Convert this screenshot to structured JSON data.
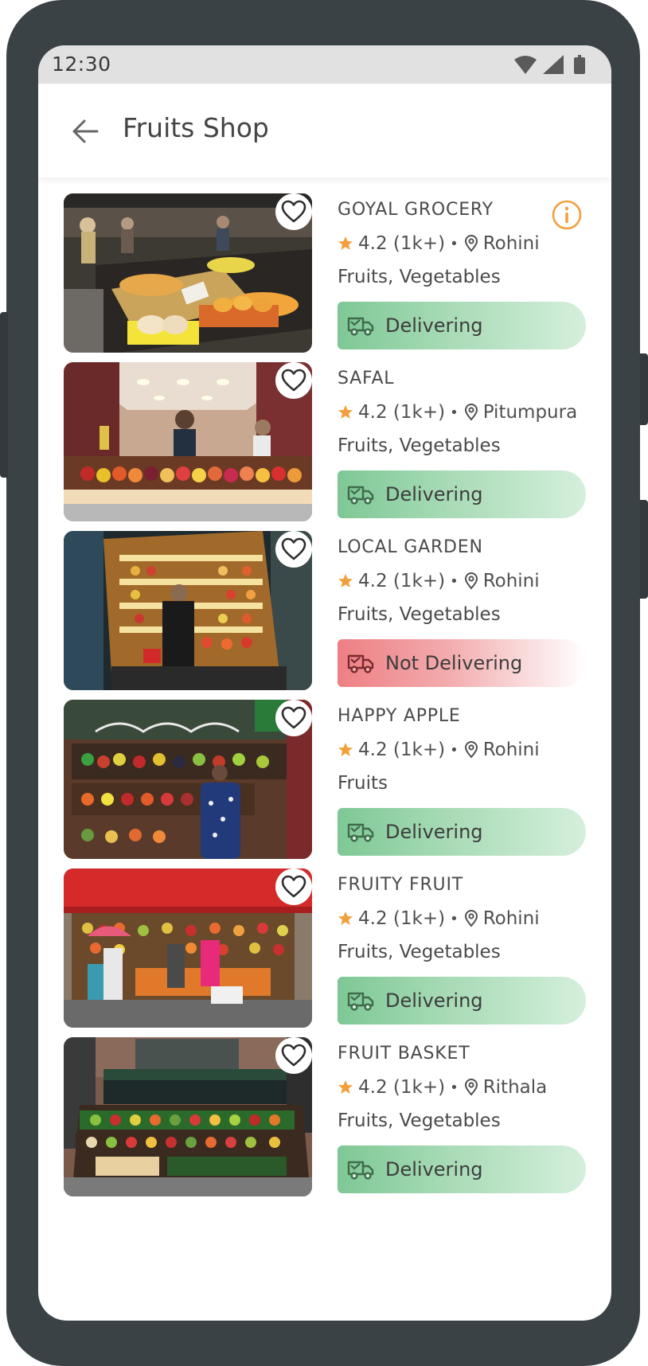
{
  "status_bar": {
    "time": "12:30"
  },
  "header": {
    "title": "Fruits Shop"
  },
  "colors": {
    "accent": "#f2a03d",
    "delivering": "#7ec895",
    "not_delivering": "#ee7f84",
    "frame": "#3b4246"
  },
  "shops": [
    {
      "name": "GOYAL GROCERY",
      "rating": "4.2",
      "reviews": "(1k+)",
      "location": "Rohini",
      "category": "Fruits, Vegetables",
      "status": "Delivering",
      "delivering": true,
      "has_info": true
    },
    {
      "name": "SAFAL",
      "rating": "4.2",
      "reviews": "(1k+)",
      "location": "Pitumpura",
      "category": "Fruits, Vegetables",
      "status": "Delivering",
      "delivering": true,
      "has_info": false
    },
    {
      "name": "LOCAL GARDEN",
      "rating": "4.2",
      "reviews": "(1k+)",
      "location": "Rohini",
      "category": "Fruits, Vegetables",
      "status": "Not Delivering",
      "delivering": false,
      "has_info": false
    },
    {
      "name": "HAPPY APPLE",
      "rating": "4.2",
      "reviews": "(1k+)",
      "location": "Rohini",
      "category": "Fruits",
      "status": "Delivering",
      "delivering": true,
      "has_info": false
    },
    {
      "name": "FRUITY FRUIT",
      "rating": "4.2",
      "reviews": "(1k+)",
      "location": "Rohini",
      "category": "Fruits, Vegetables",
      "status": "Delivering",
      "delivering": true,
      "has_info": false
    },
    {
      "name": "FRUIT BASKET",
      "rating": "4.2",
      "reviews": "(1k+)",
      "location": "Rithala",
      "category": "Fruits, Vegetables",
      "status": "Delivering",
      "delivering": true,
      "has_info": false
    }
  ],
  "icons": {
    "back": "arrow-left-icon",
    "favorite": "heart-outline-icon",
    "info": "info-circle-icon",
    "rating": "star-icon",
    "location": "map-pin-icon",
    "delivery": "delivery-truck-icon"
  }
}
